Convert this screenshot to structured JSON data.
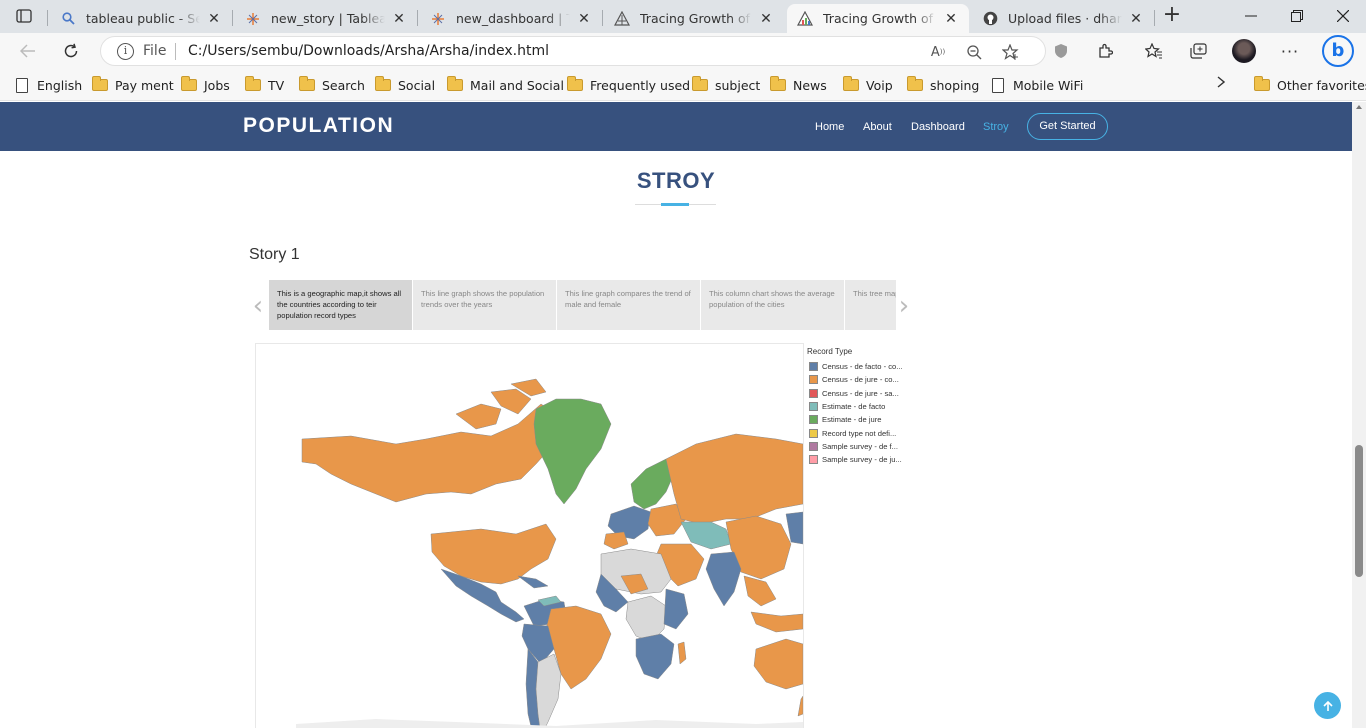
{
  "browser": {
    "tabs": [
      {
        "title": "tableau public - Search",
        "icon": "search-favicon"
      },
      {
        "title": "new_story | Tableau Public",
        "icon": "tableau-favicon"
      },
      {
        "title": "new_dashboard | Tableau Public",
        "icon": "tableau-favicon"
      },
      {
        "title": "Tracing Growth of the",
        "icon": "growth-favicon"
      },
      {
        "title": "Tracing Growth of the",
        "icon": "growth-favicon"
      },
      {
        "title": "Upload files · dhanasekar",
        "icon": "github-favicon"
      }
    ],
    "address": {
      "scheme": "File",
      "url": "C:/Users/sembu/Downloads/Arsha/Arsha/index.html"
    },
    "bookmarks": [
      {
        "label": "English",
        "kind": "page"
      },
      {
        "label": "Pay ment",
        "kind": "folder"
      },
      {
        "label": "Jobs",
        "kind": "folder"
      },
      {
        "label": "TV",
        "kind": "folder"
      },
      {
        "label": "Search",
        "kind": "folder"
      },
      {
        "label": "Social",
        "kind": "folder"
      },
      {
        "label": "Mail and Social",
        "kind": "folder"
      },
      {
        "label": "Frequently used",
        "kind": "folder"
      },
      {
        "label": "subject",
        "kind": "folder"
      },
      {
        "label": "News",
        "kind": "folder"
      },
      {
        "label": "Voip",
        "kind": "folder"
      },
      {
        "label": "shoping",
        "kind": "folder"
      },
      {
        "label": "Mobile WiFi",
        "kind": "page"
      },
      {
        "label": "Other favorites",
        "kind": "folder"
      }
    ]
  },
  "site": {
    "logo": "POPULATION",
    "nav": [
      "Home",
      "About",
      "Dashboard",
      "Stroy"
    ],
    "nav_active": "Stroy",
    "cta": "Get Started",
    "accent_color": "#47b2e4",
    "header_color": "#37517e"
  },
  "section": {
    "title": "STROY",
    "story_title": "Story 1",
    "story_points": [
      "This is a geographic map,it shows all the countries according to teir population record types",
      "This line graph shows the population trends over the years",
      "This line graph compares the trend of male and female",
      "This column chart shows the average population of the cities",
      "This tree map shows the population"
    ],
    "legend": {
      "title": "Record Type",
      "items": [
        {
          "label": "Census - de facto - co...",
          "color": "#5f7fa8"
        },
        {
          "label": "Census - de jure - co...",
          "color": "#e8974a"
        },
        {
          "label": "Census - de jure - sa...",
          "color": "#e15759"
        },
        {
          "label": "Estimate - de facto",
          "color": "#7fbcb9"
        },
        {
          "label": "Estimate - de jure",
          "color": "#6aab5e"
        },
        {
          "label": "Record type not defi...",
          "color": "#edc948"
        },
        {
          "label": "Sample survey - de f...",
          "color": "#b07aa1"
        },
        {
          "label": "Sample survey - de ju...",
          "color": "#ff9da7"
        }
      ]
    }
  }
}
